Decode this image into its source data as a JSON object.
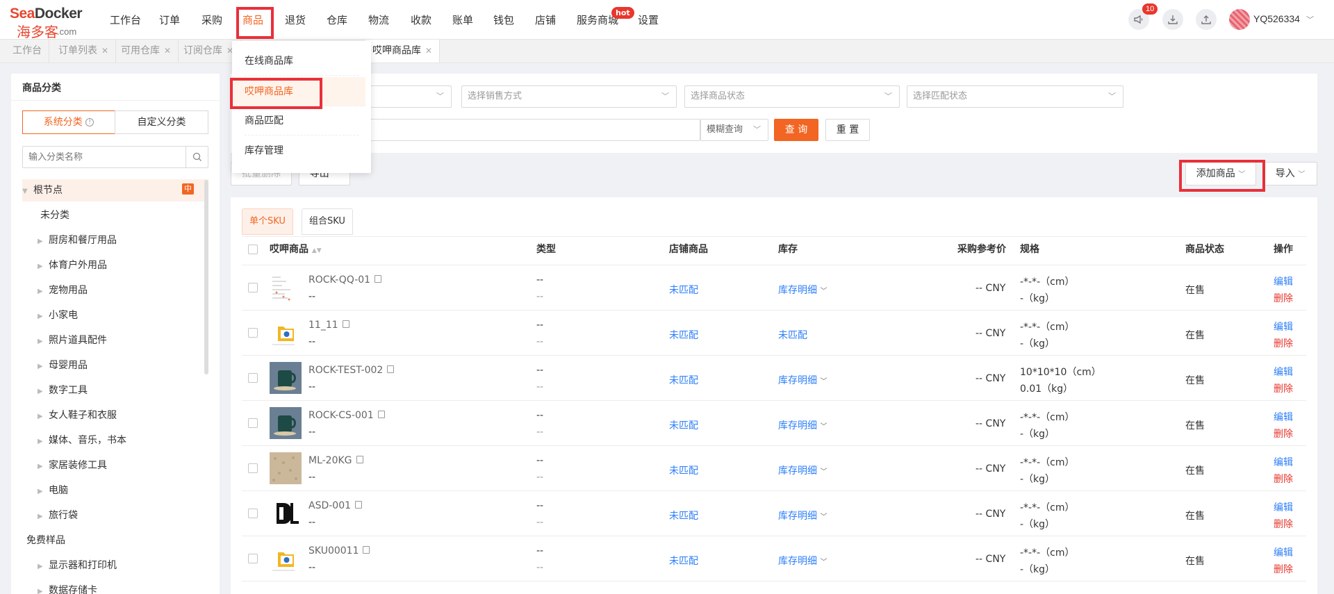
{
  "brand": {
    "logo_en_a": "Sea",
    "logo_en_b": "Docker",
    "logo_cn": "海多客",
    "logo_suffix": ".com"
  },
  "nav": {
    "items": [
      "工作台",
      "订单",
      "采购",
      "商品",
      "退货",
      "仓库",
      "物流",
      "收款",
      "账单",
      "钱包",
      "店铺",
      "服务商城",
      "设置"
    ],
    "active": "商品",
    "hot_label": "hot"
  },
  "header": {
    "notif_count": "10",
    "username": "YQ526334"
  },
  "tabs": [
    {
      "label": "工作台",
      "closable": false
    },
    {
      "label": "订单列表",
      "closable": true
    },
    {
      "label": "可用仓库",
      "closable": true
    },
    {
      "label": "订阅仓库",
      "closable": true
    },
    {
      "label": "哎呷商品库",
      "closable": true
    }
  ],
  "menu": {
    "items": [
      "在线商品库",
      "哎呷商品库",
      "商品匹配",
      "库存管理"
    ],
    "active": "哎呷商品库"
  },
  "sidebar": {
    "title": "商品分类",
    "seg_system": "系统分类",
    "seg_custom": "自定义分类",
    "search_placeholder": "输入分类名称",
    "root": "根节点",
    "root_badge": "中",
    "items": [
      {
        "label": "未分类",
        "level": 1,
        "has_children": false
      },
      {
        "label": "厨房和餐厅用品",
        "level": 1,
        "has_children": true
      },
      {
        "label": "体育户外用品",
        "level": 1,
        "has_children": true
      },
      {
        "label": "宠物用品",
        "level": 1,
        "has_children": true
      },
      {
        "label": "小家电",
        "level": 1,
        "has_children": true
      },
      {
        "label": "照片道具配件",
        "level": 1,
        "has_children": true
      },
      {
        "label": "母婴用品",
        "level": 1,
        "has_children": true
      },
      {
        "label": "数字工具",
        "level": 1,
        "has_children": true
      },
      {
        "label": "女人鞋子和衣服",
        "level": 1,
        "has_children": true
      },
      {
        "label": "媒体、音乐，书本",
        "level": 1,
        "has_children": true
      },
      {
        "label": "家居装修工具",
        "level": 1,
        "has_children": true
      },
      {
        "label": "电脑",
        "level": 1,
        "has_children": true
      },
      {
        "label": "旅行袋",
        "level": 1,
        "has_children": true
      },
      {
        "label": "免费样品",
        "level": 0,
        "has_children": false
      },
      {
        "label": "显示器和打印机",
        "level": 1,
        "has_children": true
      },
      {
        "label": "数据存储卡",
        "level": 1,
        "has_children": true
      }
    ]
  },
  "filters": {
    "sale_method": "选择销售方式",
    "status": "选择商品状态",
    "match": "选择匹配状态",
    "fuzzy": "模糊查询",
    "query_btn": "查 询",
    "reset_btn": "重 置"
  },
  "actions": {
    "batch_delete": "批量删除",
    "export": "导出",
    "add_product": "添加商品",
    "import": "导入"
  },
  "subtabs": {
    "single": "单个SKU",
    "combo": "组合SKU"
  },
  "table": {
    "headers": {
      "product": "哎呷商品",
      "type": "类型",
      "shop": "店铺商品",
      "stock": "库存",
      "price": "采购参考价",
      "spec": "规格",
      "status": "商品状态",
      "ops": "操作"
    },
    "edit": "编辑",
    "delete": "删除",
    "rows": [
      {
        "sku": "ROCK-QQ-01",
        "sub": "--",
        "type1": "--",
        "type2": "--",
        "shop": "未匹配",
        "stock": "库存明细",
        "stock_dd": true,
        "price": "-- CNY",
        "spec1": "-*-*-（cm）",
        "spec2": "-（kg）",
        "status": "在售",
        "thumb": "doc"
      },
      {
        "sku": "11_11",
        "sub": "--",
        "type1": "--",
        "type2": "--",
        "shop": "未匹配",
        "stock": "未匹配",
        "stock_dd": false,
        "price": "-- CNY",
        "spec1": "-*-*-（cm）",
        "spec2": "-（kg）",
        "status": "在售",
        "thumb": "folder"
      },
      {
        "sku": "ROCK-TEST-002",
        "sub": "--",
        "type1": "--",
        "type2": "--",
        "shop": "未匹配",
        "stock": "库存明细",
        "stock_dd": true,
        "price": "-- CNY",
        "spec1": "10*10*10（cm）",
        "spec2": "0.01（kg）",
        "status": "在售",
        "thumb": "mug"
      },
      {
        "sku": "ROCK-CS-001",
        "sub": "--",
        "type1": "--",
        "type2": "--",
        "shop": "未匹配",
        "stock": "库存明细",
        "stock_dd": true,
        "price": "-- CNY",
        "spec1": "-*-*-（cm）",
        "spec2": "-（kg）",
        "status": "在售",
        "thumb": "mug"
      },
      {
        "sku": "ML-20KG",
        "sub": "--",
        "type1": "--",
        "type2": "--",
        "shop": "未匹配",
        "stock": "库存明细",
        "stock_dd": true,
        "price": "-- CNY",
        "spec1": "-*-*-（cm）",
        "spec2": "-（kg）",
        "status": "在售",
        "thumb": "sand"
      },
      {
        "sku": "ASD-001",
        "sub": "--",
        "type1": "--",
        "type2": "--",
        "shop": "未匹配",
        "stock": "库存明细",
        "stock_dd": true,
        "price": "-- CNY",
        "spec1": "-*-*-（cm）",
        "spec2": "-（kg）",
        "status": "在售",
        "thumb": "dl"
      },
      {
        "sku": "SKU00011",
        "sub": "--",
        "type1": "--",
        "type2": "--",
        "shop": "未匹配",
        "stock": "库存明细",
        "stock_dd": true,
        "price": "-- CNY",
        "spec1": "-*-*-（cm）",
        "spec2": "-（kg）",
        "status": "在售",
        "thumb": "folder"
      }
    ]
  },
  "colors": {
    "accent": "#f26522",
    "link": "#2d7ff9",
    "danger": "#e8372c",
    "highlight_box": "#e8303a"
  }
}
